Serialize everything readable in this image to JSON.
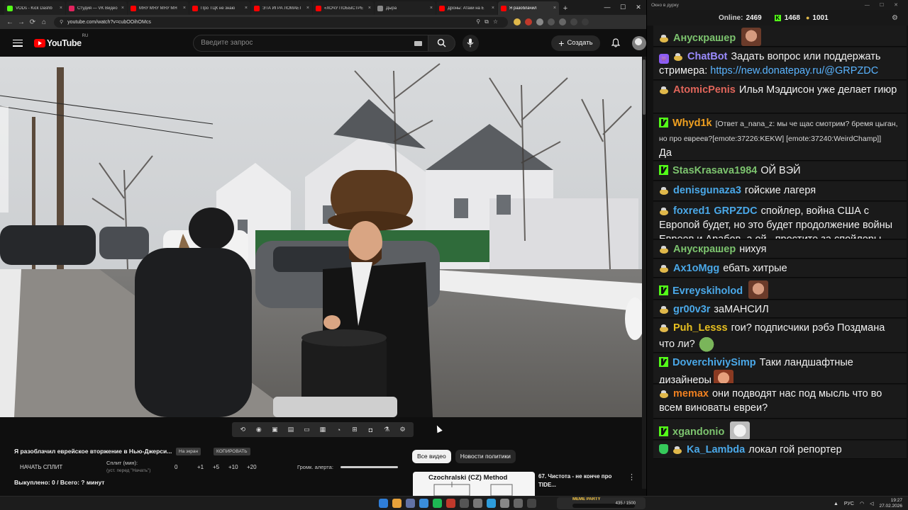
{
  "browser": {
    "tabs": [
      {
        "title": "VODs - Kick Dashb",
        "color": "#53fc18"
      },
      {
        "title": "Студия — VK Видео",
        "color": "#e0245e"
      },
      {
        "title": "МЯУ МЯУ МЯУ МЯ",
        "color": "#ff0000"
      },
      {
        "title": "Про ТЦК не знаю",
        "color": "#ff0000"
      },
      {
        "title": "ЭТА ИГРА ЛОМАЕТ",
        "color": "#ff0000"
      },
      {
        "title": "«ХОЧУ ПОБЫСТРЕ",
        "color": "#ff0000"
      },
      {
        "title": "Дырa",
        "color": "#888888"
      },
      {
        "title": "Дроны: Атаки на Е",
        "color": "#ff0000"
      },
      {
        "title": "Я разоблачил",
        "color": "#ff0000"
      }
    ],
    "url": "youtube.com/watch?v=cubOOihOMcs",
    "min": "—",
    "max": "☐",
    "close": "✕"
  },
  "youtube": {
    "logo_text": "YouTube",
    "region": "RU",
    "search_placeholder": "Введите запрос",
    "create_label": "Создать"
  },
  "video_info": {
    "title": "Я разоблачил еврейское вторжение в Нью-Джерси...",
    "btn_on_air": "На экран",
    "btn_copy": "КОПИРОВАТЬ",
    "split_label": "НАЧАТЬ СПЛИТ",
    "split_min_label": "Сплит (мин):",
    "split_min_sub": "(уст. перед \"Начать\")",
    "split_values": [
      "0",
      "+1",
      "+5",
      "+10",
      "+20"
    ],
    "alert_label": "Громк. алерта:",
    "sold": "Выкуплено: 0 / Всего: ? минут"
  },
  "recommendations": {
    "chips": [
      "Все видео",
      "Новости политики"
    ],
    "thumb_title": "Czochralski (CZ) Method",
    "title": "67. Чистота - не конче про TIDE..."
  },
  "chat_window": {
    "title": "Окно в дурку",
    "online_label": "Online:",
    "online_value": "2469",
    "kick_count": "1468",
    "other_count": "1001"
  },
  "chat": {
    "messages": [
      {
        "badge": "bee",
        "user": "Анускрашер",
        "color": "#7cc36e",
        "text": "",
        "emote": "face"
      },
      {
        "badge": "purple",
        "badge2": "bee",
        "user": "ChatBot",
        "color": "#9b8cff",
        "text": "Задать вопрос или поддержать стримера: ",
        "link": "https://new.donatepay.ru/@GRPZDC"
      },
      {
        "badge": "bee",
        "user": "AtomicPenis",
        "color": "#e0655a",
        "text": "Илья Мэддисон уже делает гиюр"
      },
      {
        "badge": "kick",
        "user": "Whyd1k",
        "color": "#f0a020",
        "small": "[Ответ a_nana_z: мы че щас смотрим? бремя цыган, но про евреев?[emote:37226:KEKW] [emote:37240:WeirdChamp]]",
        "text": "Да"
      },
      {
        "badge": "kick",
        "user": "StasKrasava1984",
        "color": "#7cc36e",
        "text": "ОЙ ВЭЙ"
      },
      {
        "badge": "bee",
        "user": "denisgunaza3",
        "color": "#4aa8e8",
        "text": "гойские лагеря"
      },
      {
        "badge": "bee",
        "user": "foxred1",
        "color": "#4aa8e8",
        "mention": "GRPZDC",
        "text": "спойлер, война США с Европой будет, но это будет продолжение войны Евреев и Арабов, а ой , простите за спойлеры"
      },
      {
        "badge": "bee",
        "user": "Анускрашер",
        "color": "#7cc36e",
        "text": "нихуя"
      },
      {
        "badge": "bee",
        "user": "Ax1oMgg",
        "color": "#4aa8e8",
        "text": "ебать хитрые"
      },
      {
        "badge": "kick",
        "user": "Evreyskiholod",
        "color": "#4aa8e8",
        "text": "",
        "emote": "face"
      },
      {
        "badge": "bee",
        "user": "gr00v3r",
        "color": "#4aa8e8",
        "text": "заМАНСИЛ"
      },
      {
        "badge": "bee",
        "user": "Puh_Lesss",
        "color": "#e8c020",
        "text": "гои? подписчики рэбэ Поздмана что ли?",
        "emote": "frog"
      },
      {
        "badge": "kick",
        "user": "DoverchiviySimp",
        "color": "#4aa8e8",
        "text": "Таки ландшафтные дизайнеры",
        "emote": "face2"
      },
      {
        "badge": "bee",
        "user": "memax",
        "color": "#f08020",
        "text": "они подводят нас под мысль что во всем виноваты евреи?"
      },
      {
        "badge": "kick",
        "user": "xgandonio",
        "color": "#7cc36e",
        "text": "",
        "emote": "cat"
      },
      {
        "badge": "shield",
        "badge2": "bee",
        "user": "Ka_Lambda",
        "color": "#4aa8e8",
        "text": "локал гой репортер"
      }
    ]
  },
  "taskbar": {
    "meme_title": "MEME PARTY",
    "meme_value": "435 / 1500",
    "lang": "РУС",
    "time": "19:27",
    "date": "27.02.2026"
  }
}
